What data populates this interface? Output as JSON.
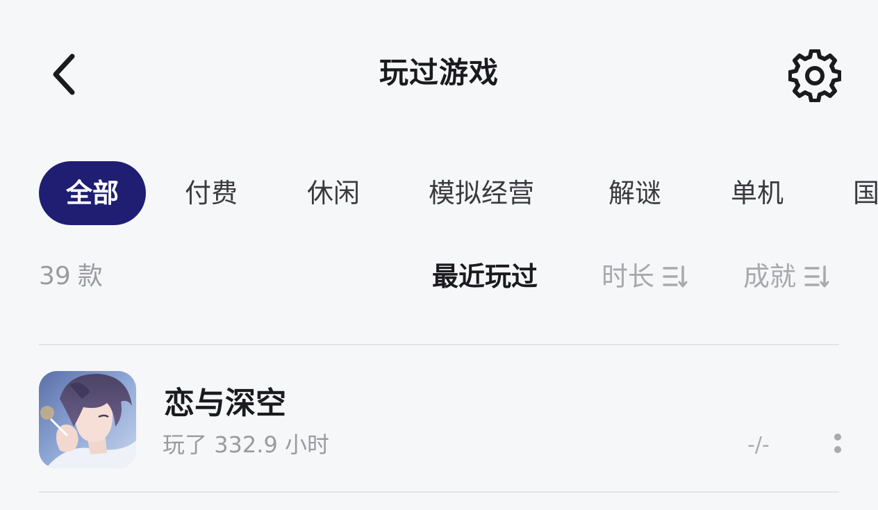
{
  "header": {
    "title": "玩过游戏",
    "back_icon": "chevron-left-icon",
    "settings_icon": "gear-icon"
  },
  "chips": [
    {
      "label": "全部",
      "active": true
    },
    {
      "label": "付费",
      "active": false
    },
    {
      "label": "休闲",
      "active": false
    },
    {
      "label": "模拟经营",
      "active": false
    },
    {
      "label": "解谜",
      "active": false
    },
    {
      "label": "单机",
      "active": false
    },
    {
      "label": "国",
      "active": false
    }
  ],
  "summary": {
    "count": "39",
    "count_unit": "款"
  },
  "sort": [
    {
      "label": "最近玩过",
      "active": true
    },
    {
      "label": "时长",
      "active": false,
      "icon": "sort-icon"
    },
    {
      "label": "成就",
      "active": false,
      "icon": "sort-icon"
    }
  ],
  "games": [
    {
      "name": "恋与深空",
      "playtime_prefix": "玩了",
      "playtime_value": "332.9",
      "playtime_unit": "小时",
      "score": "-/-",
      "more_icon": "more-vertical-icon"
    }
  ],
  "colors": {
    "background": "#f6f7f9",
    "chip_active_bg": "#1f1e73",
    "text_primary": "#1b1b1f",
    "text_muted": "#9a9a9f",
    "divider": "#e3e4e7"
  }
}
